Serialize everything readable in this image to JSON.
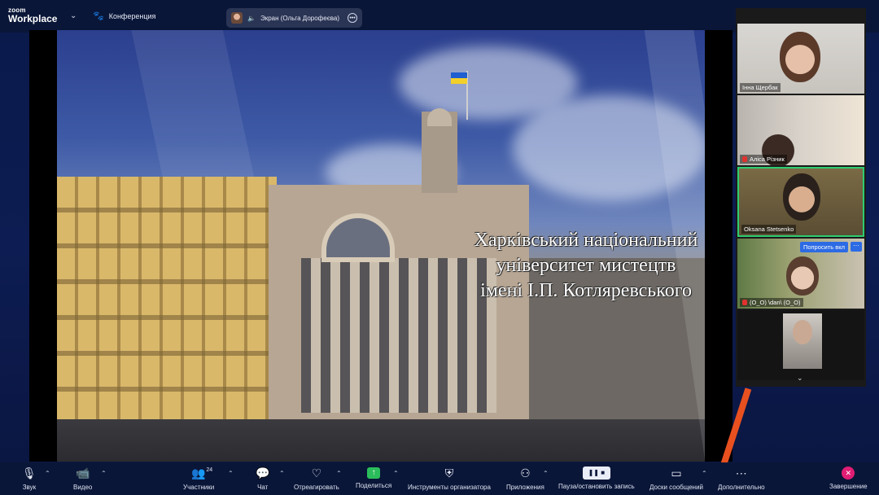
{
  "app": {
    "logo_line1": "zoom",
    "logo_line2": "Workplace",
    "meeting_label": "Конференция",
    "share_pill": "Экран (Ольга Дорофеєва)"
  },
  "slide": {
    "caption_line1": "Харківський національний",
    "caption_line2": "університет мистецтв",
    "caption_line3": "імені І.П. Котляревського"
  },
  "gallery": {
    "participants": [
      {
        "name": "Інна Щербак",
        "muted": false
      },
      {
        "name": "Аліса Різник",
        "muted": true
      },
      {
        "name": "Oksana Stetsenko",
        "muted": false,
        "active_speaker": true
      },
      {
        "name": "(O_O) \\dan\\ (O_O)",
        "muted": true,
        "action": "Попросить вкл"
      },
      {
        "name": "",
        "muted": false
      }
    ]
  },
  "toolbar": {
    "audio": "Звук",
    "video": "Видео",
    "participants": "Участники",
    "participants_count": "24",
    "chat": "Чат",
    "react": "Отреагировать",
    "share": "Поделиться",
    "host_tools": "Инструменты организатора",
    "apps": "Приложения",
    "record": "Пауза/остановить запись",
    "whiteboards": "Доски сообщений",
    "more": "Дополнительно",
    "end": "Завершение"
  },
  "colors": {
    "toolbar_bg": "#0a1638",
    "active_speaker_border": "#2ecc71",
    "share_green": "#2bbd5b",
    "end_pink": "#e11d74",
    "ask_button_blue": "#2d6be4"
  },
  "icons": [
    "audio-icon",
    "video-icon",
    "participants-icon",
    "chat-icon",
    "heart-icon",
    "share-icon",
    "shield-icon",
    "apps-icon",
    "record-icon",
    "whiteboard-icon",
    "more-icon",
    "end-icon",
    "paw-icon"
  ]
}
